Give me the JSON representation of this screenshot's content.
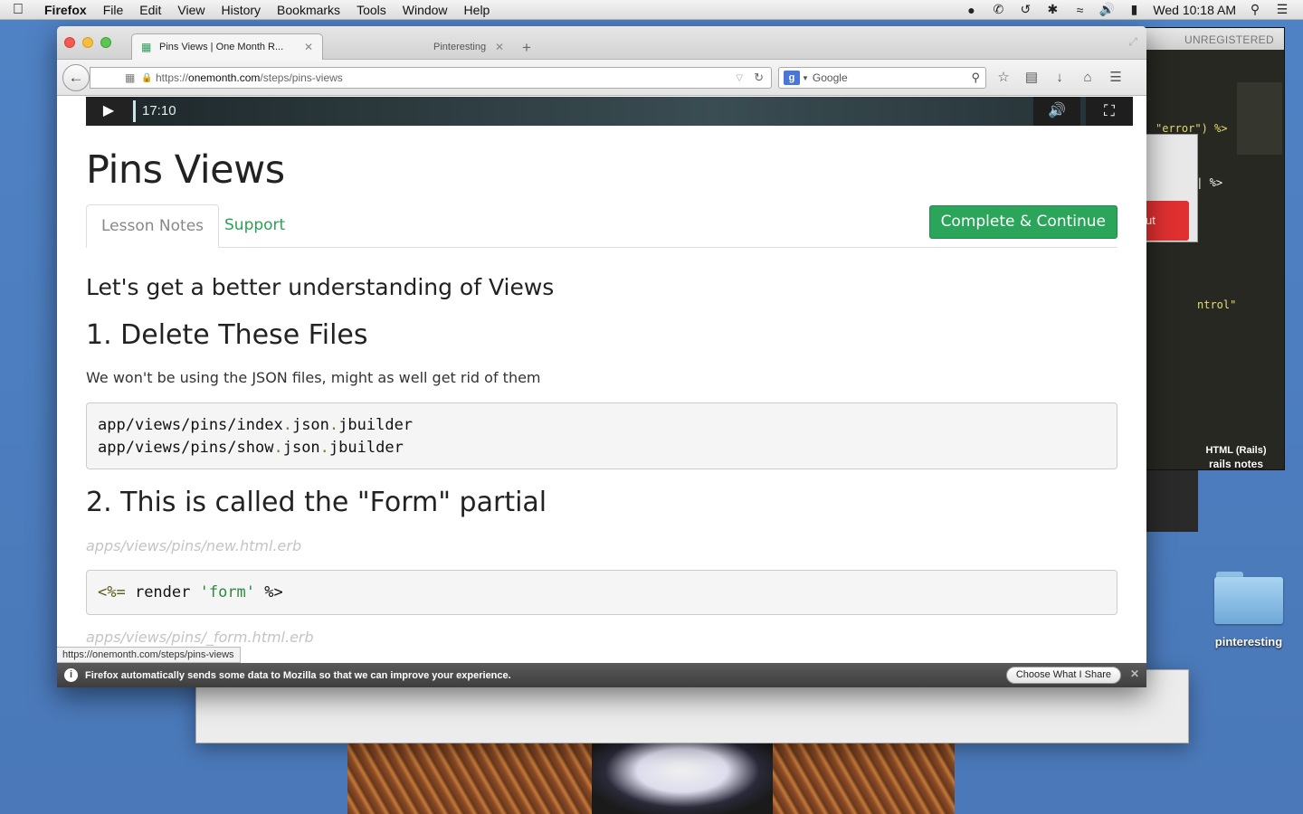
{
  "menubar": {
    "app_name": "Firefox",
    "items": [
      "File",
      "Edit",
      "View",
      "History",
      "Bookmarks",
      "Tools",
      "Window",
      "Help"
    ],
    "clock": "Wed 10:18 AM"
  },
  "browser": {
    "tabs": [
      {
        "title": "Pins Views | One Month R...",
        "active": true
      },
      {
        "title": "Pinteresting",
        "active": false
      }
    ],
    "url_prefix": "https://",
    "url_domain": "onemonth.com",
    "url_path": "/steps/pins-views",
    "search_engine_placeholder": "Google",
    "status_url": "https://onemonth.com/steps/pins-views"
  },
  "video": {
    "time": "17:10"
  },
  "page": {
    "title": "Pins Views",
    "tabs": [
      "Lesson Notes",
      "Support"
    ],
    "complete_button": "Complete & Continue",
    "lead": "Let's get a better understanding of Views",
    "section1_heading": "1. Delete These Files",
    "section1_text": "We won't be using the JSON files, might as well get rid of them",
    "section2_heading": "2. This is called the \"Form\" partial",
    "section2_path1": "apps/views/pins/new.html.erb",
    "section2_path2": "apps/views/pins/_form.html.erb"
  },
  "notification": {
    "message": "Firefox automatically sends some data to Mozilla so that we can improve your experience.",
    "button": "Choose What I Share"
  },
  "background": {
    "editor_title": "UNREGISTERED",
    "code_line1": "\"error\") %>",
    "code_line2": "e| %>",
    "code_line3": "ntrol\"",
    "red_button": "ut",
    "html_label": "HTML (Rails)",
    "rails_label": "rails notes",
    "folder_label": "pinteresting"
  }
}
